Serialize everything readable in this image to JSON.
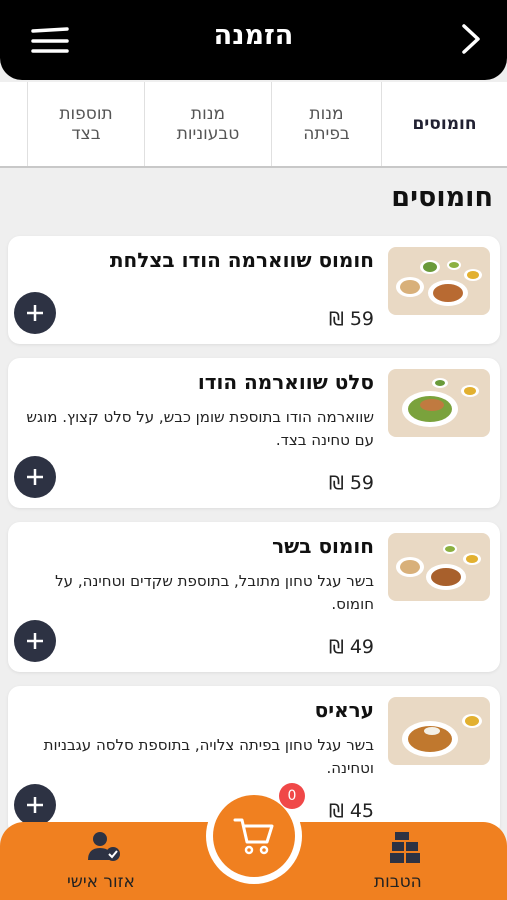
{
  "header": {
    "title": "הזמנה"
  },
  "tabs": [
    {
      "label": "חומוסים"
    },
    {
      "label": "מנות בפיתה"
    },
    {
      "label": "מנות טבעוניות"
    },
    {
      "label": "תוספות בצד"
    }
  ],
  "section_title": "חומוסים",
  "items": [
    {
      "name": "חומוס שווארמה הודו בצלחת",
      "desc": "",
      "price": "59 ₪"
    },
    {
      "name": "סלט שווארמה הודו",
      "desc": "שווארמה הודו בתוספת שומן כבש, על סלט קצוץ. מוגש עם טחינה בצד.",
      "price": "59 ₪"
    },
    {
      "name": "חומוס בשר",
      "desc": "בשר עגל טחון מתובל, בתוספת שקדים וטחינה, על חומוס.",
      "price": "49 ₪"
    },
    {
      "name": "עראיס",
      "desc": "בשר עגל טחון בפיתה צלויה, בתוספת סלסה עגבניות וטחינה.",
      "price": "45 ₪"
    }
  ],
  "cart": {
    "count": "0"
  },
  "bottom_nav": {
    "benefits": "הטבות",
    "personal": "אזור אישי"
  },
  "colors": {
    "accent": "#f08020",
    "header": "#000000",
    "add_button": "#2d3243",
    "badge": "#f04848"
  }
}
